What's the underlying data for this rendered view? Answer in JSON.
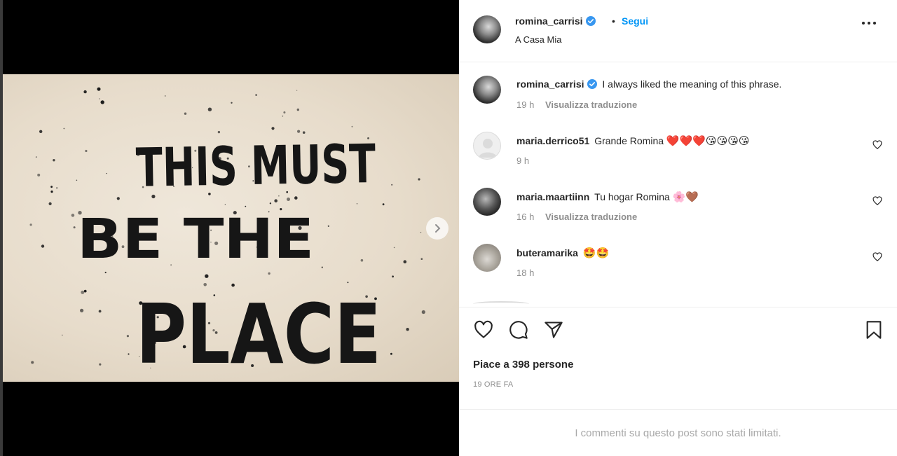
{
  "post": {
    "image_text": [
      "THIS MUST",
      "BE THE",
      "PLACE"
    ],
    "carousel": {
      "count": 2,
      "active": 1
    }
  },
  "header": {
    "username": "romina_carrisi",
    "separator": "•",
    "follow_label": "Segui",
    "location": "A Casa Mia"
  },
  "caption": {
    "username": "romina_carrisi",
    "text": "I always liked the meaning of this phrase.",
    "time": "19 h",
    "translate_label": "Visualizza traduzione"
  },
  "comments": [
    {
      "username": "maria.derrico51",
      "text": "Grande Romina",
      "emoji": "❤️❤️❤️😘😘😘😘",
      "time": "9 h",
      "translate_label": ""
    },
    {
      "username": "maria.maartiinn",
      "text": "Tu hogar Romina",
      "emoji": "🌸🤎",
      "time": "16 h",
      "translate_label": "Visualizza traduzione"
    },
    {
      "username": "buteramarika",
      "text": "",
      "emoji": "🤩🤩",
      "time": "18 h",
      "translate_label": ""
    }
  ],
  "footer": {
    "likes": "Piace a 398 persone",
    "posted": "19 ORE FA",
    "limited_notice": "I commenti su questo post sono stati limitati."
  },
  "colors": {
    "accent": "#0095f6",
    "verified": "#3897f0",
    "heart_emoji": "#ed1c24",
    "muted": "#8e8e8e"
  },
  "icons": [
    "chevron-right-icon",
    "verified-badge-icon",
    "more-options-icon",
    "heart-icon",
    "comment-icon",
    "share-icon",
    "bookmark-icon"
  ]
}
